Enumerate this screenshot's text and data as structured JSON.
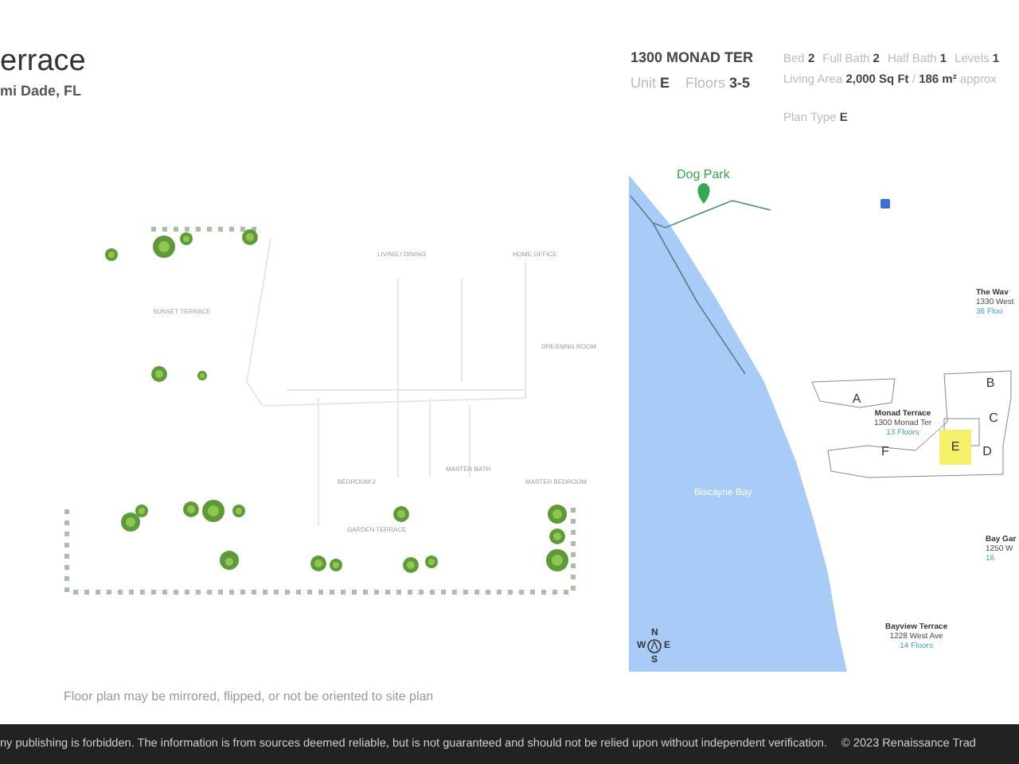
{
  "header": {
    "title": "errace",
    "location": "mi Dade, FL"
  },
  "unit_info": {
    "address": "1300 MONAD TER",
    "unit_label": "Unit",
    "unit": "E",
    "floors_label": "Floors",
    "floors": "3-5"
  },
  "specs": [
    {
      "label": "Bed",
      "value": "2"
    },
    {
      "label": "Full Bath",
      "value": "2"
    },
    {
      "label": "Half Bath",
      "value": "1"
    },
    {
      "label": "Levels",
      "value": "1"
    }
  ],
  "living_area": {
    "label": "Living Area",
    "value": "2,000 Sq Ft",
    "separator": "/",
    "metric": "186 m²",
    "suffix": "approx"
  },
  "plan_type": {
    "label": "Plan Type",
    "value": "E"
  },
  "floor_plan": {
    "rooms": [
      {
        "name": "SUNSET TERRACE"
      },
      {
        "name": "LIVING / DINING"
      },
      {
        "name": "HOME OFFICE"
      },
      {
        "name": "DRESSING ROOM"
      },
      {
        "name": "BEDROOM 2"
      },
      {
        "name": "MASTER BATH"
      },
      {
        "name": "MASTER BEDROOM"
      },
      {
        "name": "GARDEN TERRACE"
      }
    ],
    "note": "Floor plan may be mirrored, flipped, or not be oriented to site plan"
  },
  "site_map": {
    "poi": "Dog Park",
    "water": "Biscayne Bay",
    "buildings": [
      {
        "name": "The Wav",
        "address": "1330 West",
        "floors": "36 Floo"
      },
      {
        "name": "Monad Terrace",
        "address": "1300 Monad Ter",
        "floors": "13 Floors"
      },
      {
        "name": "Bay Gar",
        "address": "1250 W",
        "floors": "16"
      },
      {
        "name": "Bayview Terrace",
        "address": "1228 West Ave",
        "floors": "14 Floors"
      }
    ],
    "units": [
      {
        "label": "A",
        "selected": false
      },
      {
        "label": "B",
        "selected": false
      },
      {
        "label": "C",
        "selected": false
      },
      {
        "label": "D",
        "selected": false
      },
      {
        "label": "E",
        "selected": true
      },
      {
        "label": "F",
        "selected": false
      }
    ],
    "compass": {
      "n": "N",
      "w": "W",
      "e": "E",
      "s": "S"
    }
  },
  "footer": {
    "disclaimer": "ny publishing is forbidden. The information is from sources deemed reliable, but is not guaranteed and should not be relied upon without independent verification.",
    "copyright": "© 2023 Renaissance Trad"
  }
}
